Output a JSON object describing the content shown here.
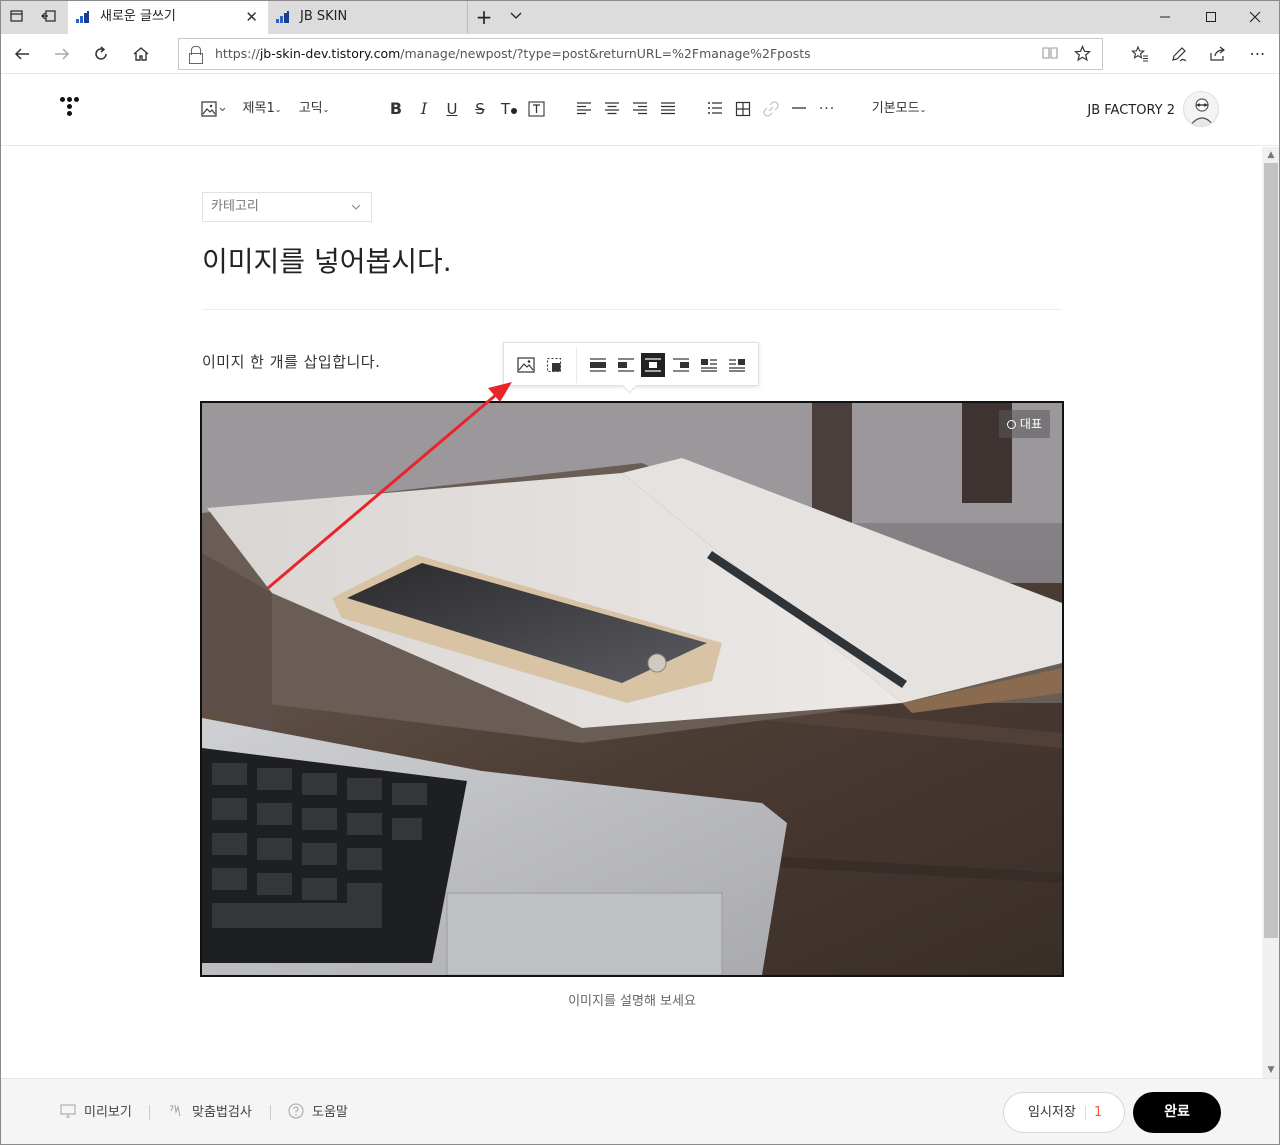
{
  "browser": {
    "tabs": [
      {
        "title": "새로운 글쓰기",
        "active": true
      },
      {
        "title": "JB SKIN",
        "active": false
      }
    ],
    "url_prefix": "https://",
    "url_domain": "jb-skin-dev.tistory.com",
    "url_path": "/manage/newpost/?type=post&returnURL=%2Fmanage%2Fposts"
  },
  "toolbar": {
    "heading": "제목1",
    "font": "고딕",
    "mode": "기본모드"
  },
  "account": {
    "name": "JB FACTORY 2"
  },
  "editor": {
    "category_placeholder": "카테고리",
    "title": "이미지를 넣어봅시다.",
    "body_text": "이미지 한 개를 삽입합니다.",
    "representative_label": "대표",
    "caption_placeholder": "이미지를 설명해 보세요"
  },
  "bottom": {
    "preview": "미리보기",
    "spellcheck": "맞춤법검사",
    "help": "도움말",
    "draft": "임시저장",
    "draft_count": "1",
    "done": "완료"
  },
  "colors": {
    "accent_red": "#e8252b",
    "draft_count": "#ff5544",
    "done_bg": "#000000",
    "active_align": "#222222"
  }
}
